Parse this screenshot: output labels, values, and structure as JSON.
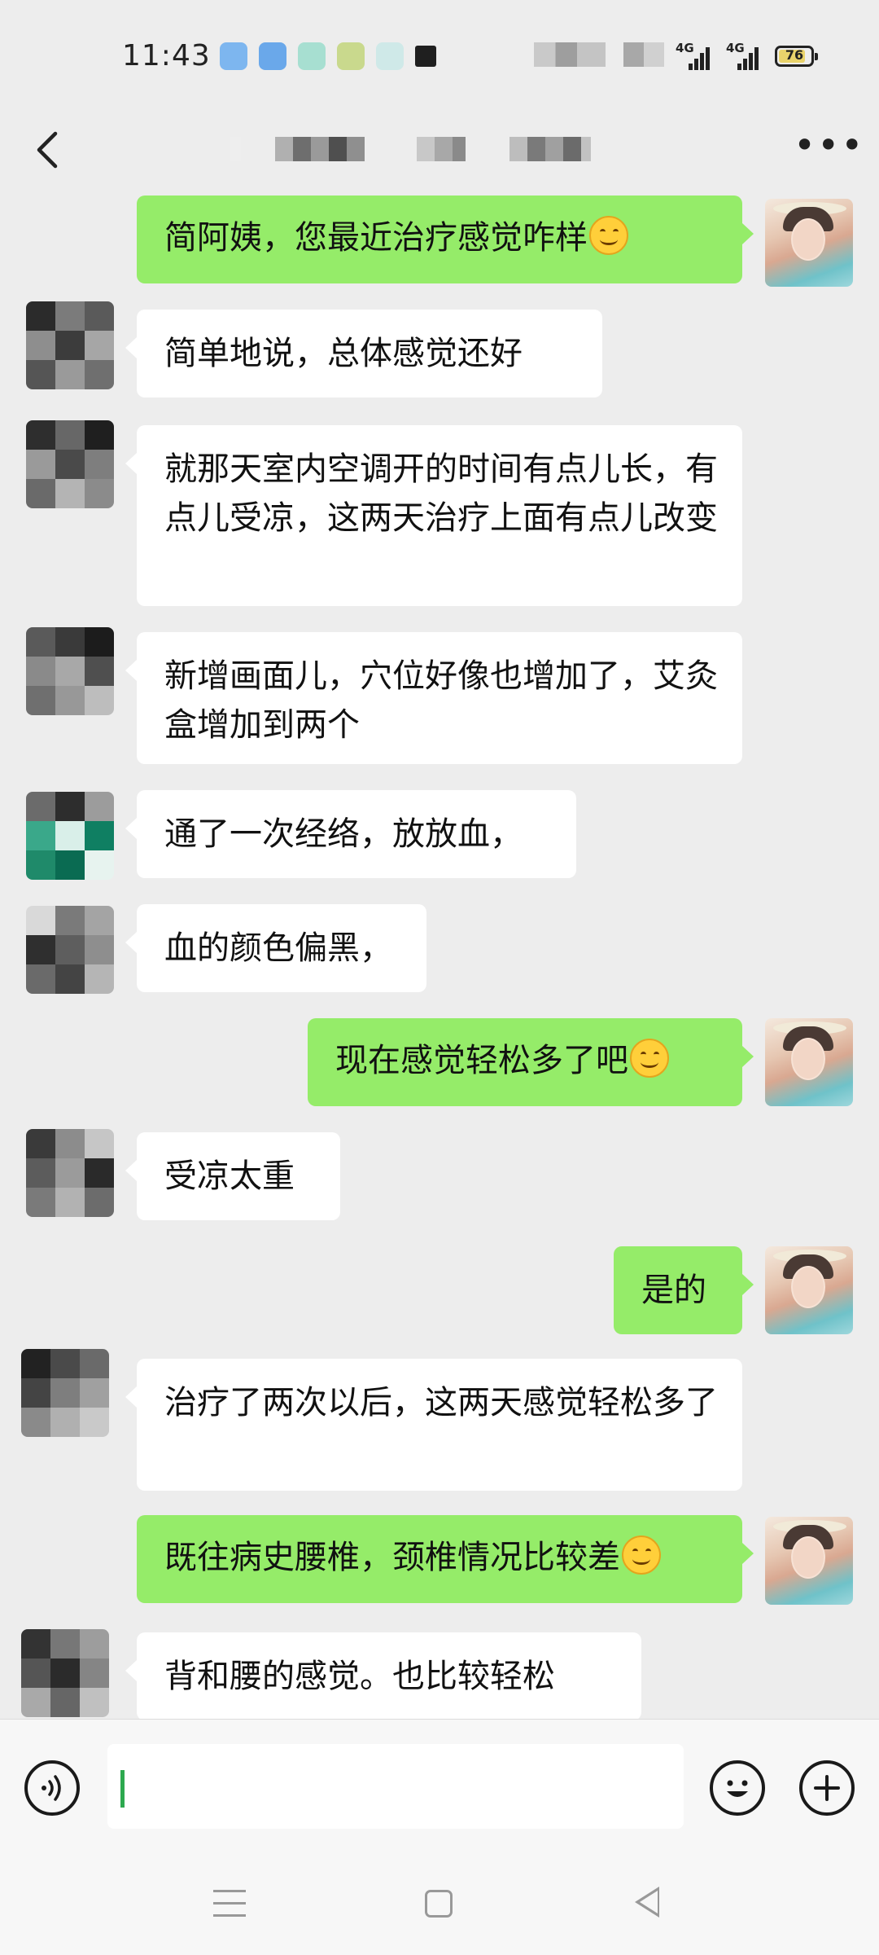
{
  "status_bar": {
    "time": "11:43",
    "network_1": "4G",
    "network_2": "4G",
    "battery": "76"
  },
  "header": {
    "back_icon": "chevron-left-icon",
    "more_icon": "more-icon"
  },
  "messages": [
    {
      "side": "right",
      "text": "简阿姨，您最近治疗感觉咋样",
      "emoji": "smile"
    },
    {
      "side": "left",
      "text": "简单地说，总体感觉还好"
    },
    {
      "side": "left",
      "text": "就那天室内空调开的时间有点儿长，有点儿受凉，这两天治疗上面有点儿改变"
    },
    {
      "side": "left",
      "text": "新增画面儿，穴位好像也增加了，艾灸盒增加到两个"
    },
    {
      "side": "left",
      "text": "通了一次经络，放放血，"
    },
    {
      "side": "left",
      "text": "血的颜色偏黑，"
    },
    {
      "side": "right",
      "text": "现在感觉轻松多了吧",
      "emoji": "smile"
    },
    {
      "side": "left",
      "text": "受凉太重"
    },
    {
      "side": "right",
      "text": "是的"
    },
    {
      "side": "left",
      "text": "治疗了两次以后，这两天感觉轻松多了"
    },
    {
      "side": "right",
      "text": "既往病史腰椎，颈椎情况比较差",
      "emoji": "smile"
    },
    {
      "side": "left",
      "text": "背和腰的感觉。也比较轻松"
    }
  ],
  "input_bar": {
    "voice_icon": "voice-icon",
    "emoji_icon": "emoji-icon",
    "add_icon": "plus-icon",
    "value": ""
  },
  "nav_bar": {
    "menu_icon": "menu-icon",
    "home_icon": "home-icon",
    "back_icon": "back-triangle-icon"
  },
  "colors": {
    "chat_bg": "#ededed",
    "bubble_self": "#95ec69",
    "bubble_other": "#ffffff"
  }
}
